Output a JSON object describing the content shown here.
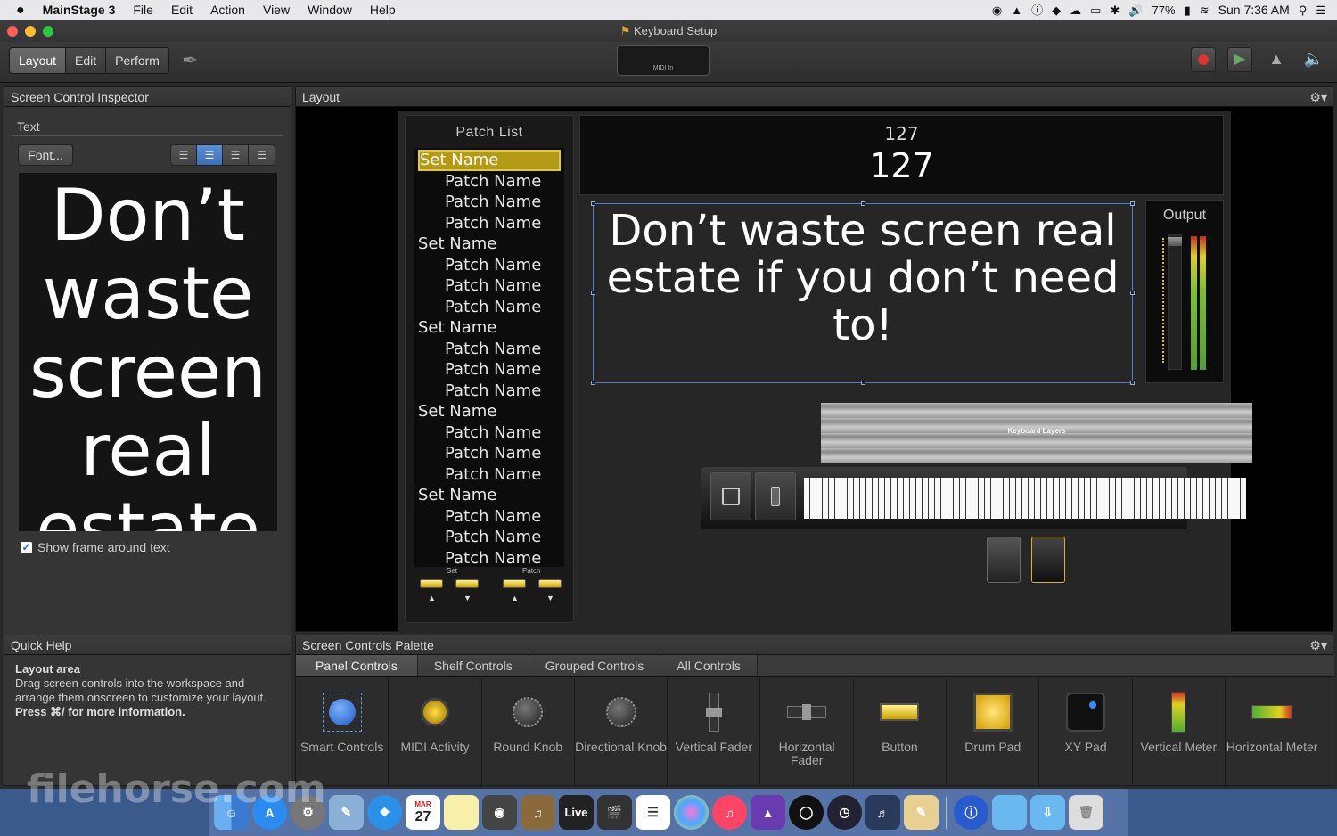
{
  "menubar": {
    "apple": "",
    "app": "MainStage 3",
    "items": [
      "File",
      "Edit",
      "Action",
      "View",
      "Window",
      "Help"
    ],
    "battery": "77%",
    "clock": "Sun 7:36 AM"
  },
  "window": {
    "title": "Keyboard Setup"
  },
  "toolbar": {
    "modes": [
      "Layout",
      "Edit",
      "Perform"
    ],
    "active_mode": "Layout",
    "midi_in_label": "MIDI In"
  },
  "inspector": {
    "title": "Screen Control Inspector",
    "section": "Text",
    "font_button": "Font...",
    "preview_text": "Don’t waste screen real estate",
    "show_frame_label": "Show frame around text",
    "show_frame_checked": true
  },
  "quick_help": {
    "title": "Quick Help",
    "heading": "Layout area",
    "body": "Drag screen controls into the workspace and arrange them onscreen to customize your layout.",
    "more": "Press ⌘/ for more information."
  },
  "layout": {
    "title": "Layout",
    "patch_list": {
      "title": "Patch List",
      "items": [
        {
          "label": "Set Name",
          "kind": "set",
          "selected": true
        },
        {
          "label": "Patch Name",
          "kind": "patch"
        },
        {
          "label": "Patch Name",
          "kind": "patch"
        },
        {
          "label": "Patch Name",
          "kind": "patch"
        },
        {
          "label": "Set Name",
          "kind": "set"
        },
        {
          "label": "Patch Name",
          "kind": "patch"
        },
        {
          "label": "Patch Name",
          "kind": "patch"
        },
        {
          "label": "Patch Name",
          "kind": "patch"
        },
        {
          "label": "Set Name",
          "kind": "set"
        },
        {
          "label": "Patch Name",
          "kind": "patch"
        },
        {
          "label": "Patch Name",
          "kind": "patch"
        },
        {
          "label": "Patch Name",
          "kind": "patch"
        },
        {
          "label": "Set Name",
          "kind": "set"
        },
        {
          "label": "Patch Name",
          "kind": "patch"
        },
        {
          "label": "Patch Name",
          "kind": "patch"
        },
        {
          "label": "Patch Name",
          "kind": "patch"
        },
        {
          "label": "Set Name",
          "kind": "set"
        },
        {
          "label": "Patch Name",
          "kind": "patch"
        },
        {
          "label": "Patch Name",
          "kind": "patch"
        },
        {
          "label": "Patch Name",
          "kind": "patch"
        }
      ],
      "set_label": "Set",
      "patch_label": "Patch"
    },
    "patch_number_small": "127",
    "patch_number_big": "127",
    "text_box": "Don’t waste screen real estate if you don’t need to!",
    "output_label": "Output",
    "keyboard_shelf_label": "Keyboard Layers"
  },
  "palette": {
    "title": "Screen Controls Palette",
    "tabs": [
      "Panel Controls",
      "Shelf Controls",
      "Grouped Controls",
      "All Controls"
    ],
    "active_tab": "Panel Controls",
    "items": [
      "Smart Controls",
      "MIDI Activity",
      "Round Knob",
      "Directional Knob",
      "Vertical Fader",
      "Horizontal Fader",
      "Button",
      "Drum Pad",
      "XY Pad",
      "Vertical Meter",
      "Horizontal Meter"
    ]
  },
  "dock": {
    "live_label": "Live",
    "calendar_month": "MAR",
    "calendar_day": "27"
  },
  "watermark": "filehorse.com"
}
